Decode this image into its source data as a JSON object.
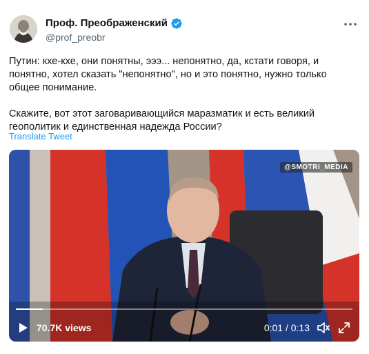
{
  "author": {
    "name": "Проф. Преображенский",
    "handle": "@prof_preobr"
  },
  "icons": {
    "verified": "verified-badge-icon",
    "more": "more-icon",
    "play": "play-icon",
    "volume": "volume-icon",
    "fullscreen": "fullscreen-icon"
  },
  "tweet": {
    "paragraph1": "Путин: кхе-кхе, они понятны, эээ... непонятно, да, кстати говоря, и понятно, хотел сказать \"непонятно\", но и это понятно, нужно только общее понимание.",
    "paragraph2": "Скажите, вот этот заговаривающийся маразматик и есть великий геополитик и единственная надежда России?",
    "translate_label": "Translate Tweet"
  },
  "video": {
    "watermark": "@SMOTRI_MEDIA",
    "views": "70.7K views",
    "time": "0:01 / 0:13",
    "progress_fraction": 0.08
  },
  "colors": {
    "accent": "#1d9bf0",
    "text_primary": "#0f1419",
    "text_secondary": "#536471"
  }
}
